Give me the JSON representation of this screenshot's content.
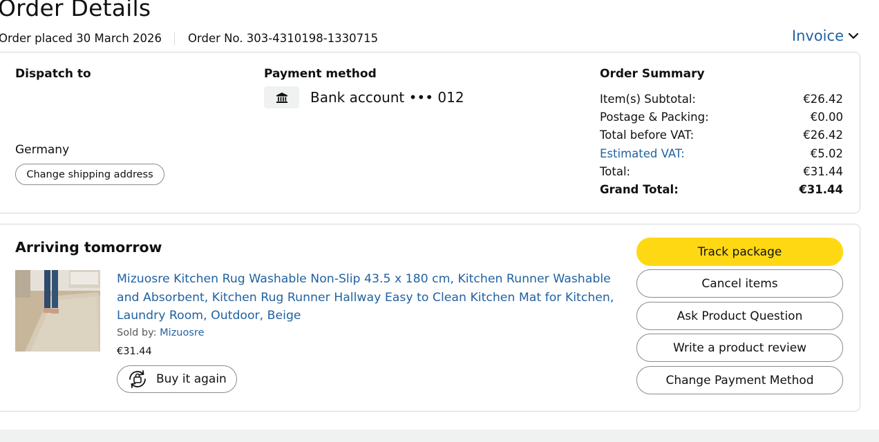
{
  "header": {
    "title": "Order Details",
    "order_placed": "Order placed 30 March 2026",
    "order_number": "Order No. 303-4310198-1330715",
    "invoice_label": "Invoice"
  },
  "dispatch": {
    "heading": "Dispatch to",
    "country": "Germany",
    "change_address_label": "Change shipping address"
  },
  "payment": {
    "heading": "Payment method",
    "icon": "bank-icon",
    "account": "Bank account ••• 012"
  },
  "summary": {
    "heading": "Order Summary",
    "rows": [
      {
        "label": "Item(s) Subtotal:",
        "value": "€26.42"
      },
      {
        "label": "Postage & Packing:",
        "value": "€0.00"
      },
      {
        "label": "Total before VAT:",
        "value": "€26.42"
      },
      {
        "label": "Estimated VAT:",
        "value": "€5.02"
      },
      {
        "label": "Total:",
        "value": "€31.44"
      },
      {
        "label": "Grand Total:",
        "value": "€31.44"
      }
    ]
  },
  "shipment": {
    "status": "Arriving tomorrow",
    "product_title": "Mizuosre Kitchen Rug Washable Non-Slip 43.5 x 180 cm, Kitchen Runner Washable and Absorbent, Kitchen Rug Runner Hallway Easy to Clean Kitchen Mat for Kitchen, Laundry Room, Outdoor, Beige",
    "sold_by_prefix": "Sold by:",
    "seller": "Mizuosre",
    "price": "€31.44",
    "buy_again_label": "Buy it again"
  },
  "actions": {
    "track": "Track package",
    "cancel": "Cancel items",
    "ask": "Ask Product Question",
    "review": "Write a product review",
    "change_payment": "Change Payment Method"
  },
  "colors": {
    "link": "#2162a1",
    "primary_button": "#ffd814",
    "border": "#d5d9d9"
  }
}
